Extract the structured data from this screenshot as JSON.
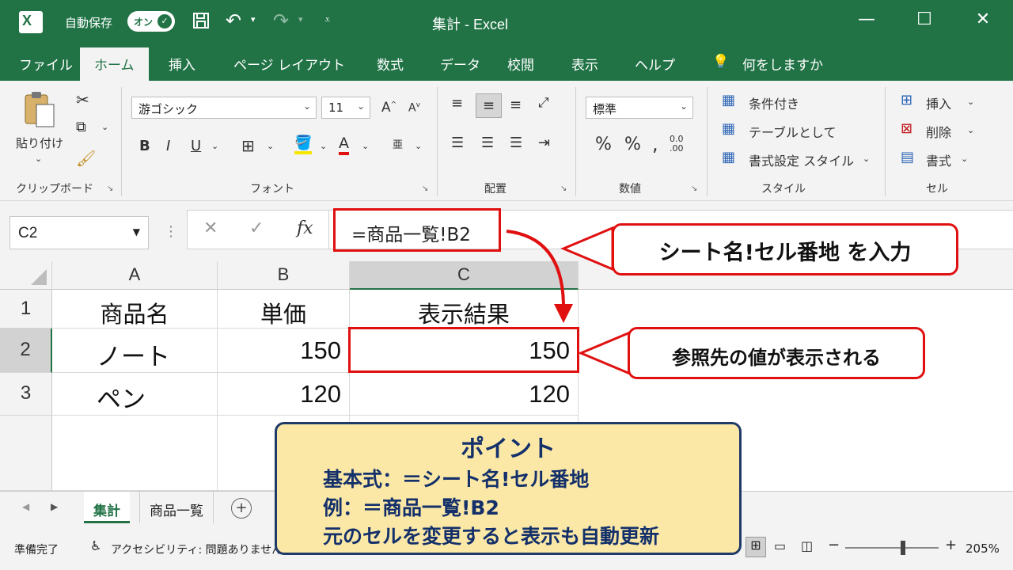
{
  "titlebar": {
    "autosave_label": "自動保存",
    "autosave_toggle": "オン",
    "title": "集計  -  Excel",
    "minimize": "—",
    "maximize": "☐",
    "close": "✕"
  },
  "tabs": [
    "ファイル",
    "ホーム",
    "挿入",
    "ページ レイアウト",
    "数式",
    "データ",
    "校閲",
    "表示",
    "ヘルプ"
  ],
  "tell_me": "何をしますか",
  "ribbon": {
    "clipboard": {
      "paste_label": "貼り付け",
      "group_label": "クリップボード"
    },
    "font": {
      "font_name": "游ゴシック",
      "font_size": "11",
      "group_label": "フォント",
      "bold": "B",
      "italic": "I",
      "underline": "U"
    },
    "alignment": {
      "group_label": "配置"
    },
    "number": {
      "format": "標準",
      "percent": "%",
      "comma": ",",
      "group_label": "数値"
    },
    "styles": {
      "conditional": "条件付き",
      "as_table": "テーブルとして",
      "cell_styles": "書式設定  スタイル",
      "group_label": "スタイル"
    },
    "cells": {
      "insert": "挿入",
      "delete": "削除",
      "format": "書式",
      "group_label": "セル"
    }
  },
  "formula_bar": {
    "name_box": "C2",
    "formula": "=商品一覧!B2",
    "fx": "fx"
  },
  "grid": {
    "columns": [
      "A",
      "B",
      "C"
    ],
    "rows": [
      {
        "num": "1",
        "a": "商品名",
        "b": "単価",
        "c": "表示結果"
      },
      {
        "num": "2",
        "a": "ノート",
        "b": "150",
        "c": "150"
      },
      {
        "num": "3",
        "a": "ペン",
        "b": "120",
        "c": "120"
      }
    ]
  },
  "sheets": [
    "集計",
    "商品一覧"
  ],
  "status": {
    "ready": "準備完了",
    "accessibility": "アクセシビリティ: 問題ありません",
    "zoom": "205%"
  },
  "annotations": {
    "callout_input": "シート名!セル番地 を入力",
    "callout_result": "参照先の値が表示される",
    "point_title": "ポイント",
    "point_lines": [
      "基本式：＝シート名!セル番地",
      "例：＝商品一覧!B2",
      "元のセルを変更すると表示も自動更新"
    ]
  },
  "colors": {
    "excel_green": "#217346",
    "callout_red": "#e01010",
    "point_bg": "#fbe8a6",
    "point_border": "#1f3a68"
  }
}
